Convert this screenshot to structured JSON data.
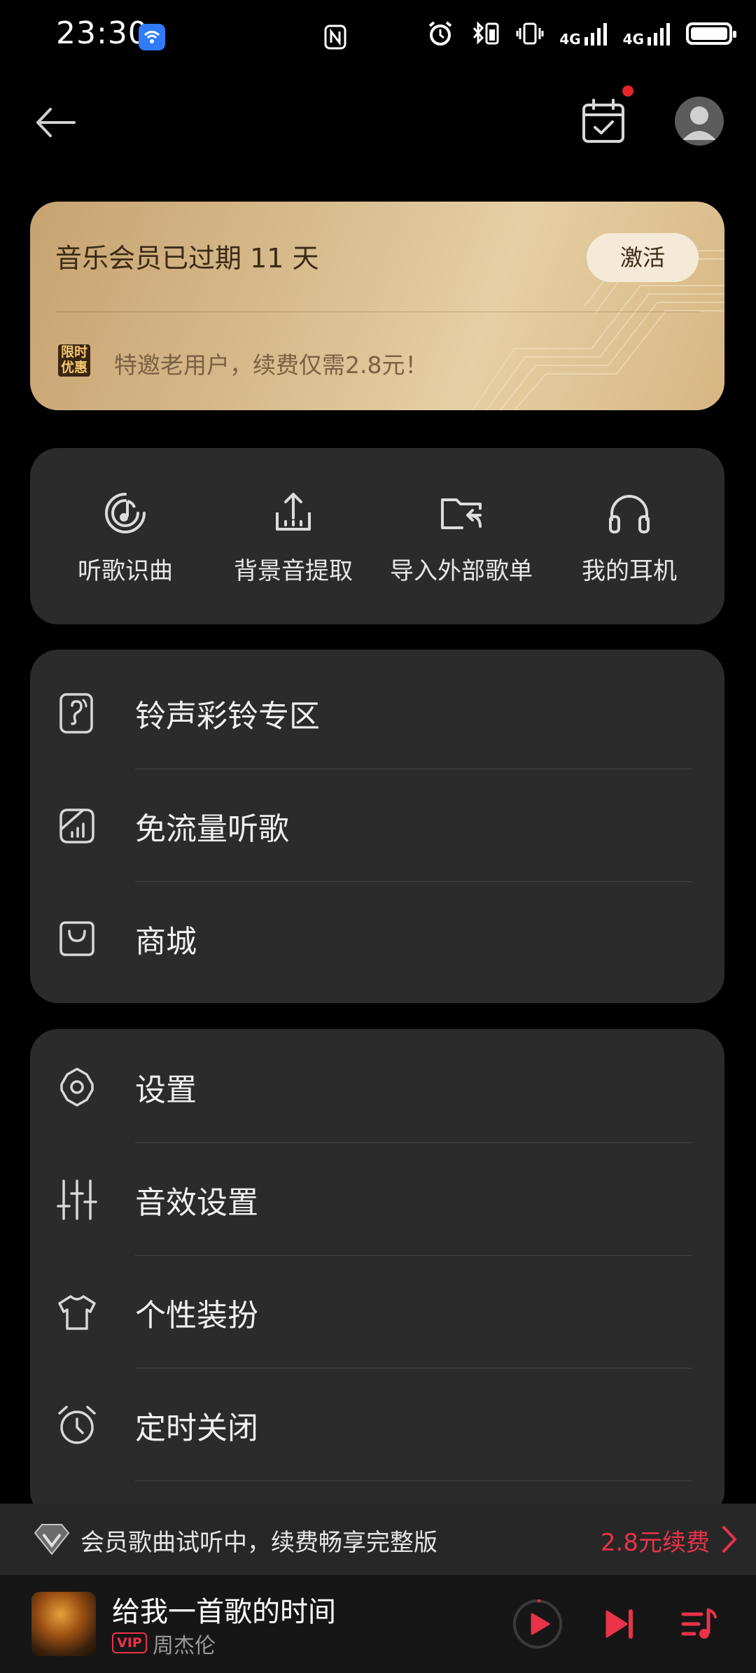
{
  "status_bar": {
    "time": "23:30",
    "net1": "4G",
    "net2": "4G"
  },
  "member_card": {
    "title": "音乐会员已过期 11 天",
    "activate_label": "激活",
    "badge_line1": "限时",
    "badge_line2": "优惠",
    "offer_text": "特邀老用户，续费仅需2.8元！"
  },
  "tools": [
    {
      "label": "听歌识曲",
      "icon": "music-recognition-icon"
    },
    {
      "label": "背景音提取",
      "icon": "upload-extract-icon"
    },
    {
      "label": "导入外部歌单",
      "icon": "folder-import-icon"
    },
    {
      "label": "我的耳机",
      "icon": "headphones-icon"
    }
  ],
  "menu_group1": [
    {
      "label": "铃声彩铃专区",
      "icon": "ringtone-icon"
    },
    {
      "label": "免流量听歌",
      "icon": "data-free-icon"
    },
    {
      "label": "商城",
      "icon": "shopping-bag-icon"
    }
  ],
  "menu_group2": [
    {
      "label": "设置",
      "icon": "gear-icon"
    },
    {
      "label": "音效设置",
      "icon": "equalizer-icon"
    },
    {
      "label": "个性装扮",
      "icon": "tshirt-icon"
    },
    {
      "label": "定时关闭",
      "icon": "alarm-clock-icon"
    }
  ],
  "vip_bar": {
    "text": "会员歌曲试听中，续费畅享完整版",
    "renew_label": "2.8元续费"
  },
  "player": {
    "song": "给我一首歌的时间",
    "vip_tag": "VIP",
    "artist": "周杰伦"
  },
  "colors": {
    "accent_red": "#e8334a",
    "gold": "#d8bd8f",
    "card_bg": "#2b2b2b"
  }
}
